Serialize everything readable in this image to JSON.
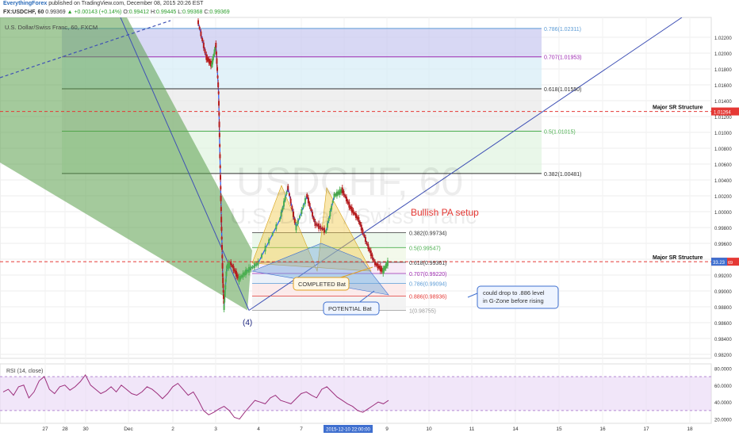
{
  "header": {
    "author": "EverythingForex",
    "published": "published on TradingView.com, December 08, 2015 20:26 EST",
    "symbol": "FX:USDCHF, 60",
    "last": "0.99369",
    "change": "+0.00143 (+0.14%)",
    "open": "0.99412",
    "high": "0.99445",
    "low": "0.99368",
    "close": "0.99369",
    "series_label": "U.S. Dollar/Swiss Franc, 60, FXCM"
  },
  "watermark": {
    "line1": "USDCHF, 60",
    "line2": "U.S. Dollar / Swiss Franc"
  },
  "colors": {
    "up_candle": "#4caf50",
    "down_candle": "#b71c1c",
    "price_line": "#2962ff",
    "sr_line": "#e53935",
    "fib_0786": "#5b9bd5",
    "fib_0707": "#9c27b0",
    "fib_0618": "#333333",
    "fib_05": "#4caf50",
    "fib_0886": "#e53935",
    "bat_fill": "#f2c94c",
    "bat2_fill": "#6fa8dc",
    "rsi_line": "#9c2f7c"
  },
  "chart_data": {
    "type": "candlestick",
    "symbol": "USDCHF",
    "ylim": [
      0.9815,
      1.0245
    ],
    "y_ticks": [
      "1.02200",
      "1.02000",
      "1.01800",
      "1.01600",
      "1.01400",
      "1.01200",
      "1.01000",
      "1.00800",
      "1.00600",
      "1.00400",
      "1.00200",
      "1.00000",
      "0.99800",
      "0.99600",
      "0.99400",
      "0.99200",
      "0.99000",
      "0.98800",
      "0.98600",
      "0.98400",
      "0.98200"
    ],
    "x_ticks": [
      "27",
      "28",
      "30",
      "Dec",
      "2",
      "3",
      "4",
      "7",
      "8",
      "9",
      "10",
      "11",
      "14",
      "15",
      "16",
      "17",
      "18"
    ],
    "crosshair_date": "2015-12-10 22:00:00",
    "price_tag": "33.23",
    "sr_tag": "1.01264",
    "sr_tag2": "0.99369",
    "price_path": [
      [
        "3",
        1.0239
      ],
      [
        "3.3",
        1.0195
      ],
      [
        "3.5",
        1.0185
      ],
      [
        "3.65",
        1.021
      ],
      [
        "3.75",
        1.015
      ],
      [
        "3.8",
        1.007
      ],
      [
        "3.85",
        0.999
      ],
      [
        "3.9",
        0.992
      ],
      [
        "3.95",
        0.9879
      ],
      [
        "4.05",
        0.993
      ],
      [
        "4.2",
        0.9935
      ],
      [
        "4.5",
        0.9915
      ],
      [
        "4.8",
        0.9925
      ],
      [
        "5.2",
        0.9935
      ],
      [
        "6",
        0.999
      ],
      [
        "6.3",
        1.003
      ],
      [
        "6.6",
        0.998
      ],
      [
        "7",
        1.002
      ],
      [
        "7.3",
        0.9985
      ],
      [
        "7.7",
        0.9975
      ],
      [
        "8",
        1.002
      ],
      [
        "8.3",
        1.0027
      ],
      [
        "8.6",
        1.0005
      ],
      [
        "8.9",
        0.999
      ],
      [
        "9.2",
        0.996
      ],
      [
        "9.5",
        0.9935
      ],
      [
        "9.8",
        0.9925
      ],
      [
        "10",
        0.9937
      ]
    ],
    "fib_levels": [
      {
        "label": "0.786(1.02311)",
        "value": 1.02311
      },
      {
        "label": "0.707(1.01953)",
        "value": 1.01953
      },
      {
        "label": "0.618(1.01550)",
        "value": 1.0155
      },
      {
        "label": "0.5(1.01015)",
        "value": 1.01015
      },
      {
        "label": "0.382(1.00481)",
        "value": 1.00481
      },
      {
        "label": "0.382(0.99734)",
        "value": 0.99734
      },
      {
        "label": "0.5(0.99547)",
        "value": 0.99547
      },
      {
        "label": "0.618(0.99361)",
        "value": 0.99361
      },
      {
        "label": "0.707(0.99220)",
        "value": 0.9922
      },
      {
        "label": "0.786(0.99094)",
        "value": 0.99094
      },
      {
        "label": "0.886(0.98936)",
        "value": 0.98936
      },
      {
        "label": "1(0.98755)",
        "value": 0.98755
      }
    ],
    "sr_levels": [
      {
        "label": "Major SR Structure",
        "value": 1.01264
      },
      {
        "label": "Major SR Structure",
        "value": 0.99369
      }
    ],
    "rsi": {
      "label": "RSI (14, close)",
      "ylim": [
        15,
        85
      ],
      "ticks": [
        "80.0000",
        "60.0000",
        "40.0000",
        "20.0000"
      ],
      "values": [
        52,
        55,
        48,
        58,
        60,
        45,
        52,
        65,
        70,
        55,
        50,
        58,
        60,
        54,
        58,
        64,
        72,
        60,
        55,
        50,
        53,
        58,
        52,
        60,
        55,
        50,
        48,
        52,
        58,
        55,
        50,
        44,
        50,
        58,
        62,
        55,
        48,
        52,
        42,
        30,
        25,
        28,
        32,
        35,
        30,
        22,
        20,
        28,
        35,
        42,
        40,
        38,
        45,
        48,
        42,
        40,
        38,
        44,
        50,
        52,
        48,
        45,
        55,
        58,
        52,
        46,
        42,
        38,
        35,
        30,
        28,
        32,
        36,
        40,
        38,
        42
      ]
    }
  },
  "annotations": {
    "point4": "(4)",
    "bullish": "Bullish PA setup",
    "completed": "COMPLETED Bat",
    "potential": "POTENTIAL Bat",
    "note_line1": "could drop to .886 level",
    "note_line2": "in G-Zone before rising"
  }
}
